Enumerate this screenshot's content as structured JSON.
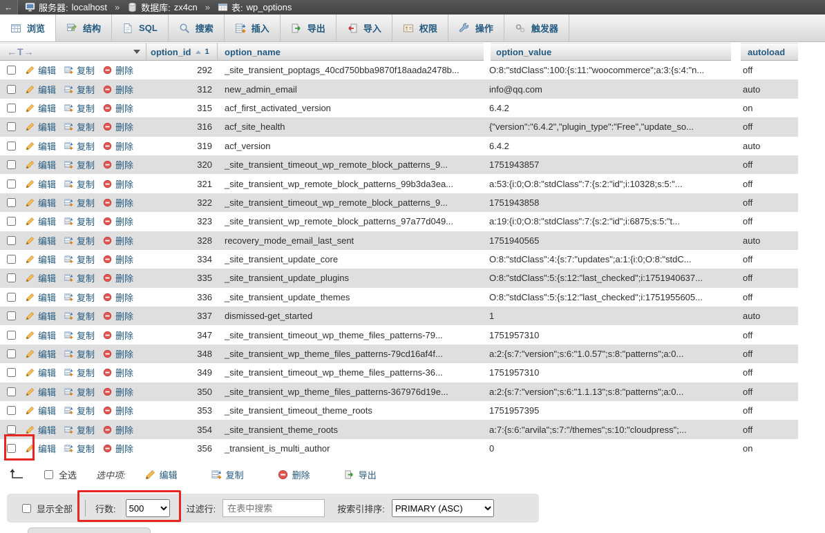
{
  "breadcrumb": {
    "back_glyph": "←",
    "server_label": "服务器:",
    "server": "localhost",
    "sep": "»",
    "db_label": "数据库:",
    "db": "zx4cn",
    "table_label": "表:",
    "table": "wp_options"
  },
  "tabs": [
    {
      "label": "浏览",
      "active": true
    },
    {
      "label": "结构",
      "active": false
    },
    {
      "label": "SQL",
      "active": false
    },
    {
      "label": "搜索",
      "active": false
    },
    {
      "label": "插入",
      "active": false
    },
    {
      "label": "导出",
      "active": false
    },
    {
      "label": "导入",
      "active": false
    },
    {
      "label": "权限",
      "active": false
    },
    {
      "label": "操作",
      "active": false
    },
    {
      "label": "触发器",
      "active": false
    }
  ],
  "table": {
    "col_options_glyph": "←T→",
    "columns": {
      "id": "option_id",
      "id_sort_order": "1",
      "name": "option_name",
      "value": "option_value",
      "autoload": "autoload"
    },
    "row_actions": {
      "edit": "编辑",
      "copy": "复制",
      "delete": "删除"
    },
    "rows": [
      {
        "id": "292",
        "name": "_site_transient_poptags_40cd750bba9870f18aada2478b...",
        "value": "O:8:\"stdClass\":100:{s:11:\"woocommerce\";a:3:{s:4:\"n...",
        "autoload": "off"
      },
      {
        "id": "312",
        "name": "new_admin_email",
        "value": "info@qq.com",
        "autoload": "auto"
      },
      {
        "id": "315",
        "name": "acf_first_activated_version",
        "value": "6.4.2",
        "autoload": "on"
      },
      {
        "id": "316",
        "name": "acf_site_health",
        "value": "{\"version\":\"6.4.2\",\"plugin_type\":\"Free\",\"update_so...",
        "autoload": "off"
      },
      {
        "id": "319",
        "name": "acf_version",
        "value": "6.4.2",
        "autoload": "auto"
      },
      {
        "id": "320",
        "name": "_site_transient_timeout_wp_remote_block_patterns_9...",
        "value": "1751943857",
        "autoload": "off"
      },
      {
        "id": "321",
        "name": "_site_transient_wp_remote_block_patterns_99b3da3ea...",
        "value": "a:53:{i:0;O:8:\"stdClass\":7:{s:2:\"id\";i:10328;s:5:\"...",
        "autoload": "off"
      },
      {
        "id": "322",
        "name": "_site_transient_timeout_wp_remote_block_patterns_9...",
        "value": "1751943858",
        "autoload": "off"
      },
      {
        "id": "323",
        "name": "_site_transient_wp_remote_block_patterns_97a77d049...",
        "value": "a:19:{i:0;O:8:\"stdClass\":7:{s:2:\"id\";i:6875;s:5:\"t...",
        "autoload": "off"
      },
      {
        "id": "328",
        "name": "recovery_mode_email_last_sent",
        "value": "1751940565",
        "autoload": "auto"
      },
      {
        "id": "334",
        "name": "_site_transient_update_core",
        "value": "O:8:\"stdClass\":4:{s:7:\"updates\";a:1:{i:0;O:8:\"stdC...",
        "autoload": "off"
      },
      {
        "id": "335",
        "name": "_site_transient_update_plugins",
        "value": "O:8:\"stdClass\":5:{s:12:\"last_checked\";i:1751940637...",
        "autoload": "off"
      },
      {
        "id": "336",
        "name": "_site_transient_update_themes",
        "value": "O:8:\"stdClass\":5:{s:12:\"last_checked\";i:1751955605...",
        "autoload": "off"
      },
      {
        "id": "337",
        "name": "dismissed-get_started",
        "value": "1",
        "autoload": "auto"
      },
      {
        "id": "347",
        "name": "_site_transient_timeout_wp_theme_files_patterns-79...",
        "value": "1751957310",
        "autoload": "off"
      },
      {
        "id": "348",
        "name": "_site_transient_wp_theme_files_patterns-79cd16af4f...",
        "value": "a:2:{s:7:\"version\";s:6:\"1.0.57\";s:8:\"patterns\";a:0...",
        "autoload": "off"
      },
      {
        "id": "349",
        "name": "_site_transient_timeout_wp_theme_files_patterns-36...",
        "value": "1751957310",
        "autoload": "off"
      },
      {
        "id": "350",
        "name": "_site_transient_wp_theme_files_patterns-367976d19e...",
        "value": "a:2:{s:7:\"version\";s:6:\"1.1.13\";s:8:\"patterns\";a:0...",
        "autoload": "off"
      },
      {
        "id": "353",
        "name": "_site_transient_timeout_theme_roots",
        "value": "1751957395",
        "autoload": "off"
      },
      {
        "id": "354",
        "name": "_site_transient_theme_roots",
        "value": "a:7:{s:6:\"arvila\";s:7:\"/themes\";s:10:\"cloudpress\";...",
        "autoload": "off"
      },
      {
        "id": "356",
        "name": "_transient_is_multi_author",
        "value": "0",
        "autoload": "on"
      }
    ]
  },
  "selection_bar": {
    "check_all": "全选",
    "selected_label": "选中项:",
    "edit": "编辑",
    "copy": "复制",
    "delete": "删除",
    "export": "导出"
  },
  "footer": {
    "show_all": "显示全部",
    "rows_label": "行数:",
    "rows_value": "500",
    "filter_label": "过滤行:",
    "filter_placeholder": "在表中搜索",
    "sort_label": "按索引排序:",
    "sort_value": "PRIMARY (ASC)"
  },
  "colors": {
    "accent": "#235a81",
    "stripe": "#dfdfdf",
    "topbar": "#4b4b4b",
    "highlight_red": "#e8251f"
  }
}
